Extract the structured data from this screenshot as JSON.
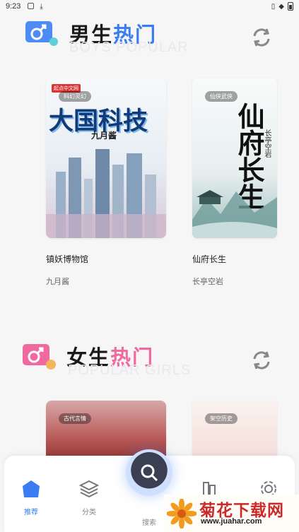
{
  "status_bar": {
    "time": "9:23"
  },
  "boys_section": {
    "title_plain": "男生",
    "title_accent": "热门",
    "subtitle": "BOYS POPULAR",
    "books": [
      {
        "title": "镇妖博物馆",
        "author": "九月酱",
        "tag": "科幻灵幻",
        "cover_text": "大国科技",
        "cover_author": "九月酱",
        "publisher": "起点中文网"
      },
      {
        "title": "仙府长生",
        "author": "长亭空岩",
        "tag": "仙侠武侠",
        "cover_text": "仙府长生",
        "cover_author": "长亭空岩"
      }
    ]
  },
  "girls_section": {
    "title_plain": "女生",
    "title_accent": "热门",
    "subtitle": "POPULAR GIRLS",
    "books": [
      {
        "tag": "古代言情"
      },
      {
        "tag": "架空历史"
      }
    ]
  },
  "tabbar": {
    "items": [
      {
        "label": "推荐",
        "icon": "home-icon",
        "active": true
      },
      {
        "label": "分类",
        "icon": "layers-icon",
        "active": false
      },
      {
        "label": "搜索",
        "icon": "search-icon",
        "active": false
      },
      {
        "label": "",
        "icon": "bookshelf-icon",
        "active": false
      },
      {
        "label": "",
        "icon": "settings-icon",
        "active": false
      }
    ]
  },
  "watermark": {
    "text": "菊花下载网",
    "url": "www.juahar.com"
  },
  "colors": {
    "accent": "#3a7df2",
    "pink": "#f06a9f",
    "watermark": "#c92a2a"
  }
}
